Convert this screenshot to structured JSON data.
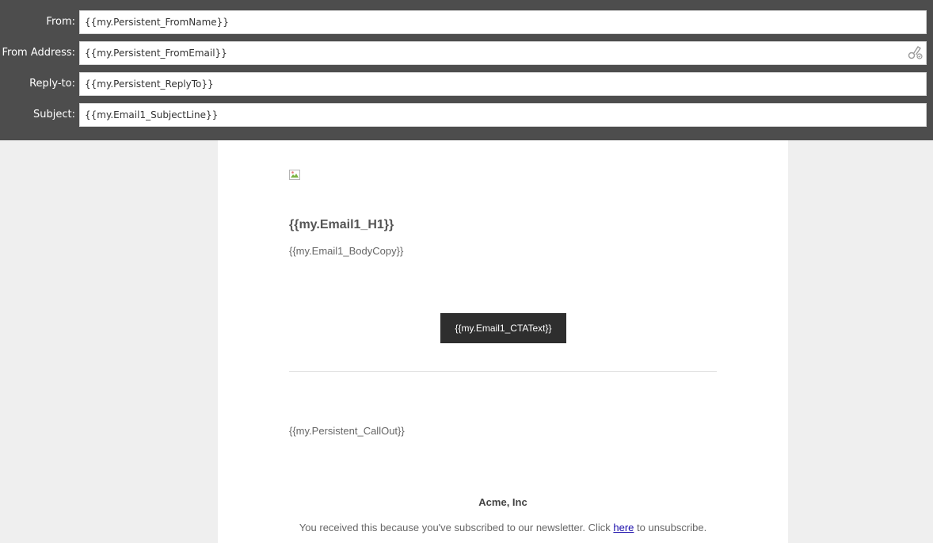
{
  "header": {
    "from": {
      "label": "From:",
      "value": "{{my.Persistent_FromName}}"
    },
    "from_address": {
      "label": "From Address:",
      "value": "{{my.Persistent_FromEmail}}"
    },
    "reply_to": {
      "label": "Reply-to:",
      "value": "{{my.Persistent_ReplyTo}}"
    },
    "subject": {
      "label": "Subject:",
      "value": "{{my.Email1_SubjectLine}}"
    }
  },
  "email": {
    "h1": "{{my.Email1_H1}}",
    "body_copy": "{{my.Email1_BodyCopy}}",
    "cta_text": "{{my.Email1_CTAText}}",
    "callout": "{{my.Persistent_CallOut}}",
    "company": "Acme, Inc",
    "footer_before": "You received this because you've subscribed to our newsletter. Click ",
    "footer_link": "here",
    "footer_after": " to unsubscribe."
  },
  "colors": {
    "header_bg": "#4d4d4d",
    "page_bg": "#efefef",
    "cta_bg": "#2e2e2e",
    "link": "#1a0dab"
  },
  "icons": {
    "tokens": "token-picker-icon",
    "image": "broken-image-icon"
  }
}
